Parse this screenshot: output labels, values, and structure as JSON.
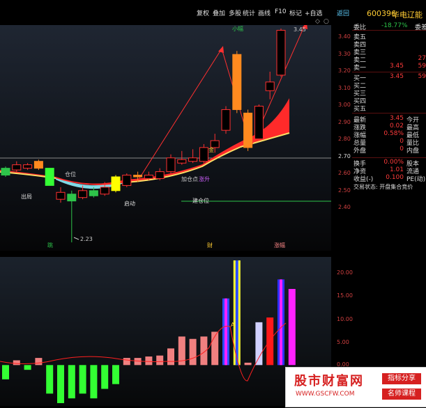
{
  "toolbar": {
    "items": [
      "复权",
      "叠加",
      "多股",
      "统计",
      "画线",
      "F10",
      "标记",
      "+自选",
      "返回"
    ]
  },
  "stock": {
    "code": "600396",
    "name": "华电辽能"
  },
  "main_axis_labels": [
    "3.40",
    "3.30",
    "3.20",
    "3.10",
    "3.00",
    "2.90",
    "2.80",
    "2.70",
    "2.60",
    "2.50",
    "2.40"
  ],
  "sub_axis_labels": [
    "20.00",
    "15.00",
    "10.00",
    "5.00",
    "0.00"
  ],
  "chart_labels": {
    "high": "3.45",
    "low": "2.23",
    "jiacang": "加仓点",
    "zhangsheng": "涨升",
    "jiancang": "建仓位",
    "qidong": "启动",
    "chuju": "出局",
    "wei": "仓位",
    "jin": "金",
    "top_label": "小幅",
    "sig1": "跳",
    "sig2": "财",
    "sig3": "涨幅",
    "sub_mark": "A"
  },
  "quote": {
    "weibi": {
      "label": "委比",
      "value": "-18.77%",
      "label2": "委差"
    },
    "asks": [
      {
        "label": "卖五",
        "price": "",
        "vol": ""
      },
      {
        "label": "卖四",
        "price": "",
        "vol": ""
      },
      {
        "label": "卖三",
        "price": "",
        "vol": ""
      },
      {
        "label": "卖二",
        "price": "",
        "vol": "27"
      },
      {
        "label": "卖一",
        "price": "3.45",
        "vol": "59"
      }
    ],
    "bids": [
      {
        "label": "买一",
        "price": "3.45",
        "vol": "59"
      },
      {
        "label": "买二",
        "price": "",
        "vol": ""
      },
      {
        "label": "买三",
        "price": "",
        "vol": ""
      },
      {
        "label": "买四",
        "price": "",
        "vol": ""
      },
      {
        "label": "买五",
        "price": "",
        "vol": ""
      }
    ],
    "stats": [
      {
        "label": "最新",
        "value": "3.45",
        "label2": "今开"
      },
      {
        "label": "涨跌",
        "value": "0.02",
        "label2": "最高"
      },
      {
        "label": "涨幅",
        "value": "0.58%",
        "label2": "最低"
      },
      {
        "label": "总量",
        "value": "0",
        "label2": "量比"
      },
      {
        "label": "外盘",
        "value": "0",
        "label2": "内盘"
      }
    ],
    "extra": [
      {
        "label": "换手",
        "value": "0.00%",
        "label2": "股本"
      },
      {
        "label": "净资",
        "value": "1.01",
        "label2": "流通"
      },
      {
        "label": "收益(-)",
        "value": "0.100",
        "label2": "PE(动)"
      }
    ],
    "status": "交易状态: 开盘集合竞价"
  },
  "watermark": {
    "title": "股市财富网",
    "url": "WWW.GSCFW.COM",
    "btn1": "指标分享",
    "btn2": "名师课程"
  },
  "chart_data": {
    "type": "bar",
    "candles": [
      {
        "o": 2.62,
        "c": 2.66,
        "h": 2.67,
        "l": 2.61,
        "up": false
      },
      {
        "o": 2.65,
        "c": 2.68,
        "h": 2.7,
        "l": 2.64,
        "up": true
      },
      {
        "o": 2.66,
        "c": 2.68,
        "h": 2.69,
        "l": 2.65,
        "up": true
      },
      {
        "o": 2.7,
        "c": 2.66,
        "h": 2.71,
        "l": 2.65,
        "up": false
      },
      {
        "o": 2.66,
        "c": 2.56,
        "h": 2.66,
        "l": 2.56,
        "up": false
      },
      {
        "o": 2.48,
        "c": 2.52,
        "h": 2.55,
        "l": 2.46,
        "up": true
      },
      {
        "o": 2.51,
        "c": 2.47,
        "h": 2.53,
        "l": 2.23,
        "up": false
      },
      {
        "o": 2.49,
        "c": 2.53,
        "h": 2.56,
        "l": 2.48,
        "up": true
      },
      {
        "o": 2.53,
        "c": 2.5,
        "h": 2.55,
        "l": 2.49,
        "up": false
      },
      {
        "o": 2.51,
        "c": 2.55,
        "h": 2.58,
        "l": 2.5,
        "up": true
      },
      {
        "o": 2.53,
        "c": 2.61,
        "h": 2.62,
        "l": 2.52,
        "up": true
      },
      {
        "o": 2.56,
        "c": 2.62,
        "h": 2.63,
        "l": 2.55,
        "up": true
      },
      {
        "o": 2.62,
        "c": 2.61,
        "h": 2.64,
        "l": 2.58,
        "up": true
      },
      {
        "o": 2.6,
        "c": 2.62,
        "h": 2.64,
        "l": 2.59,
        "up": true
      },
      {
        "o": 2.6,
        "c": 2.64,
        "h": 2.66,
        "l": 2.59,
        "up": true
      },
      {
        "o": 2.64,
        "c": 2.72,
        "h": 2.74,
        "l": 2.63,
        "up": true
      },
      {
        "o": 2.69,
        "c": 2.71,
        "h": 2.76,
        "l": 2.68,
        "up": true
      },
      {
        "o": 2.7,
        "c": 2.72,
        "h": 2.77,
        "l": 2.69,
        "up": true
      },
      {
        "o": 2.7,
        "c": 2.78,
        "h": 2.8,
        "l": 2.69,
        "up": true
      },
      {
        "o": 2.78,
        "c": 2.82,
        "h": 2.86,
        "l": 2.75,
        "up": true
      },
      {
        "o": 2.88,
        "c": 3.0,
        "h": 3.02,
        "l": 2.86,
        "up": true
      },
      {
        "o": 3.32,
        "c": 3.0,
        "h": 3.34,
        "l": 2.98,
        "up": false
      },
      {
        "o": 2.98,
        "c": 2.78,
        "h": 3.0,
        "l": 2.76,
        "up": false
      },
      {
        "o": 2.83,
        "c": 3.02,
        "h": 3.03,
        "l": 2.82,
        "up": true
      },
      {
        "o": 3.11,
        "c": 3.16,
        "h": 3.22,
        "l": 3.06,
        "up": true
      },
      {
        "o": 3.2,
        "c": 3.46,
        "h": 3.47,
        "l": 3.19,
        "up": true
      }
    ],
    "volume_bars": [
      -3,
      1,
      -1,
      1.5,
      -6,
      -8,
      -7,
      -6,
      -7,
      -5,
      -4,
      1.5,
      1.5,
      1.8,
      2,
      3.5,
      6,
      5.5,
      6,
      7,
      14,
      22,
      0.5,
      9,
      10,
      18,
      16
    ],
    "ylim": [
      2.4,
      3.45
    ],
    "sub_ylim": [
      -8,
      22
    ]
  }
}
